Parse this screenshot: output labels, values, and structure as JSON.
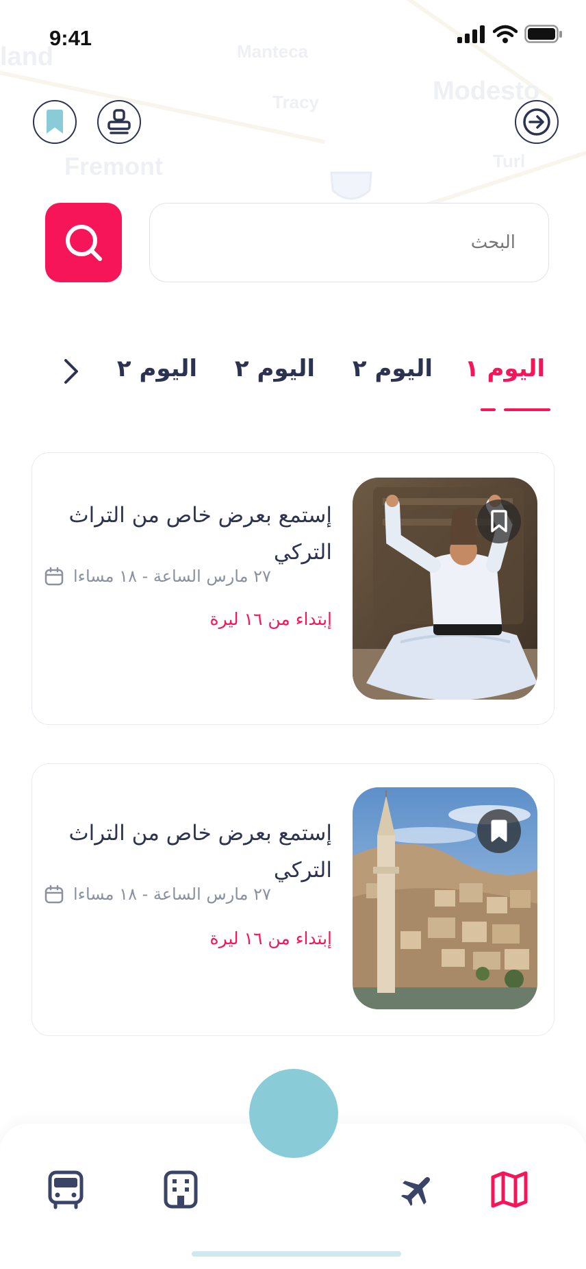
{
  "status_bar": {
    "time": "9:41"
  },
  "map_labels": [
    "Manteca",
    "Modesto",
    "Tracy",
    "Fremont",
    "Turl",
    "land"
  ],
  "header": {
    "bookmark_button": "bookmark-icon",
    "profile_button": "stamp-icon",
    "logout_button": "arrow-right-circle-icon"
  },
  "search": {
    "placeholder": "البحث"
  },
  "tabs": [
    {
      "label": "اليوم ١",
      "active": true
    },
    {
      "label": "اليوم ٢",
      "active": false
    },
    {
      "label": "اليوم ٢",
      "active": false
    },
    {
      "label": "اليوم ٢",
      "active": false
    }
  ],
  "events": [
    {
      "title": "إستمع بعرض خاص من التراث التركي",
      "date": "٢٧ مارس الساعة - ١٨ مساءا",
      "price": "إبتداء من ١٦ ليرة"
    },
    {
      "title": "إستمع بعرض خاص من التراث التركي",
      "date": "٢٧ مارس الساعة - ١٨ مساءا",
      "price": "إبتداء من ١٦ ليرة"
    }
  ],
  "bottom_nav": [
    "bus-icon",
    "building-icon",
    "plane-icon",
    "map-icon"
  ],
  "colors": {
    "accent": "#f7155a",
    "text": "#2b3350",
    "teal": "#89ccd8"
  }
}
